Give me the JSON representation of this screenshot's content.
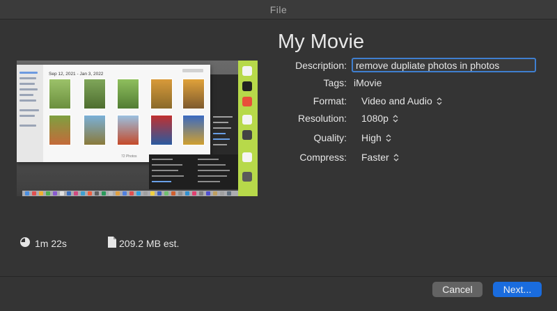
{
  "window": {
    "title": "File"
  },
  "preview": {
    "date_range": "Sep 12, 2021 - Jan 3, 2022",
    "count": "72 Photos"
  },
  "movie_title": "My Movie",
  "fields": {
    "description": {
      "label": "Description:",
      "value": "remove dupliate photos in photos"
    },
    "tags": {
      "label": "Tags:",
      "value": "iMovie"
    },
    "format": {
      "label": "Format:",
      "value": "Video and Audio"
    },
    "resolution": {
      "label": "Resolution:",
      "value": "1080p"
    },
    "quality": {
      "label": "Quality:",
      "value": "High"
    },
    "compress": {
      "label": "Compress:",
      "value": "Faster"
    }
  },
  "meta": {
    "duration": "1m 22s",
    "size": "209.2 MB est."
  },
  "buttons": {
    "cancel": "Cancel",
    "next": "Next..."
  },
  "colors": {
    "accent": "#1a6cde",
    "focus_ring": "#3f7fd0",
    "background": "#343434"
  },
  "icons": {
    "duration": "clock-icon",
    "size": "document-icon",
    "popup": "chevron-updown-icon"
  }
}
